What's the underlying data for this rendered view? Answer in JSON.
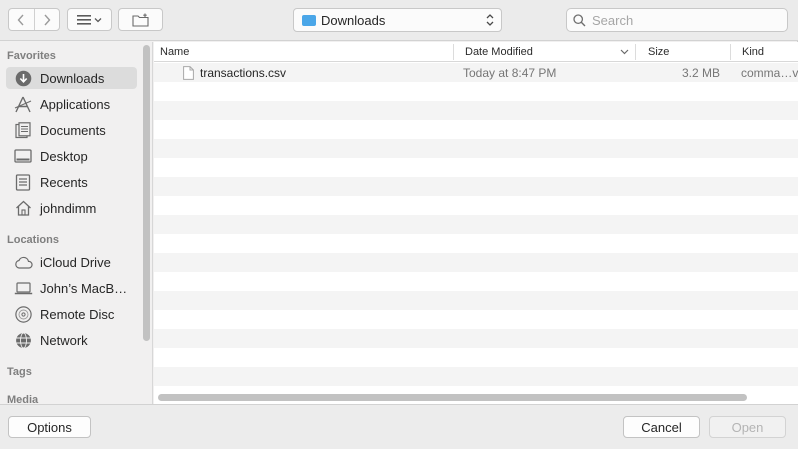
{
  "toolbar": {
    "location": "Downloads",
    "search_placeholder": "Search"
  },
  "sidebar": {
    "favorites_title": "Favorites",
    "favorites": [
      {
        "label": "Downloads",
        "icon": "downloads-icon",
        "selected": true
      },
      {
        "label": "Applications",
        "icon": "applications-icon"
      },
      {
        "label": "Documents",
        "icon": "documents-icon"
      },
      {
        "label": "Desktop",
        "icon": "desktop-icon"
      },
      {
        "label": "Recents",
        "icon": "recents-icon"
      },
      {
        "label": "johndimm",
        "icon": "home-icon"
      }
    ],
    "locations_title": "Locations",
    "locations": [
      {
        "label": "iCloud Drive",
        "icon": "cloud-icon"
      },
      {
        "label": "John’s MacB…",
        "icon": "laptop-icon"
      },
      {
        "label": "Remote Disc",
        "icon": "disc-icon"
      },
      {
        "label": "Network",
        "icon": "network-icon"
      }
    ],
    "tags_title": "Tags",
    "media_title": "Media"
  },
  "columns": {
    "name": "Name",
    "date": "Date Modified",
    "size": "Size",
    "kind": "Kind"
  },
  "files": [
    {
      "name": "transactions.csv",
      "date": "Today at 8:47 PM",
      "size": "3.2 MB",
      "kind": "comma…v"
    }
  ],
  "buttons": {
    "options": "Options",
    "cancel": "Cancel",
    "open": "Open"
  },
  "colors": {
    "folder_accent": "#4aa6e8",
    "selected_row": "#dcdcdc"
  }
}
